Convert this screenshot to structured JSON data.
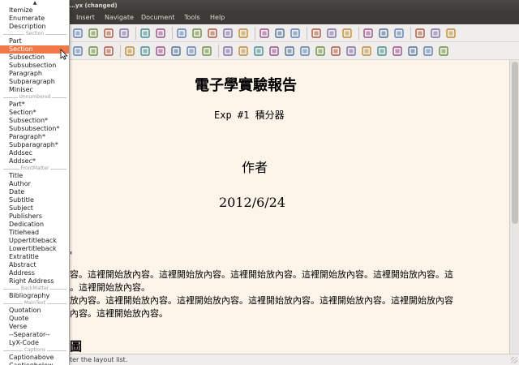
{
  "window": {
    "title": "…yx (changed)"
  },
  "menu": [
    "Insert",
    "Navigate",
    "Document",
    "Tools",
    "Help"
  ],
  "document": {
    "title": "電子學實驗報告",
    "subtitle": "Exp #1 積分器",
    "author": "作者",
    "date": "2012/6/24",
    "section_mark": "'",
    "para1_line1": "容。這裡開始放內容。這裡開始放內容。這裡開始放內容。這裡開始放內容。這裡開始放內容。這",
    "para1_line2": "。這裡開始放內容。",
    "para2_line1": "放內容。這裡開始放內容。這裡開始放內容。這裡開始放內容。這裡開始放內容。這裡開始放內容",
    "para2_line2": "內容。這裡開始放內容。",
    "figure_label": "圖"
  },
  "status": {
    "text": "ter the layout list."
  },
  "layout_popup": {
    "items": [
      {
        "label": "Itemize"
      },
      {
        "label": "Enumerate"
      },
      {
        "label": "Description"
      },
      {
        "category": "Section"
      },
      {
        "label": "Part"
      },
      {
        "label": "Section",
        "selected": true
      },
      {
        "label": "Subsection"
      },
      {
        "label": "Subsubsection"
      },
      {
        "label": "Paragraph"
      },
      {
        "label": "Subparagraph"
      },
      {
        "label": "Minisec"
      },
      {
        "category": "Unnumbered"
      },
      {
        "label": "Part*"
      },
      {
        "label": "Section*"
      },
      {
        "label": "Subsection*"
      },
      {
        "label": "Subsubsection*"
      },
      {
        "label": "Paragraph*"
      },
      {
        "label": "Subparagraph*"
      },
      {
        "label": "Addsec"
      },
      {
        "label": "Addsec*"
      },
      {
        "category": "FrontMatter"
      },
      {
        "label": "Title"
      },
      {
        "label": "Author"
      },
      {
        "label": "Date"
      },
      {
        "label": "Subtitle"
      },
      {
        "label": "Subject"
      },
      {
        "label": "Publishers"
      },
      {
        "label": "Dedication"
      },
      {
        "label": "Titlehead"
      },
      {
        "label": "Uppertitleback"
      },
      {
        "label": "Lowertitleback"
      },
      {
        "label": "Extratitle"
      },
      {
        "label": "Abstract"
      },
      {
        "label": "Address"
      },
      {
        "label": "Right Address"
      },
      {
        "category": "BackMatter"
      },
      {
        "label": "Bibliography"
      },
      {
        "category": "MainText"
      },
      {
        "label": "Quotation"
      },
      {
        "label": "Quote"
      },
      {
        "label": "Verse"
      },
      {
        "label": "--Separator--"
      },
      {
        "label": "LyX-Code"
      },
      {
        "category": "Captions"
      },
      {
        "label": "Captionabove"
      },
      {
        "label": "Captionbelow"
      }
    ]
  },
  "toolbar1": [
    "new-doc-icon",
    "save-icon",
    "save-as-icon",
    "print-icon",
    "sep",
    "spellcheck-icon",
    "check-icon",
    "sep",
    "undo-icon",
    "redo-icon",
    "cut-icon",
    "copy-icon",
    "paste-icon",
    "sep",
    "find-icon",
    "find-replace-icon",
    "zoom-icon",
    "sep",
    "math-mode-icon",
    "emphasize-icon",
    "noun-icon",
    "sep",
    "sum-icon",
    "chart-icon",
    "table-icon",
    "sep",
    "compass-icon",
    "formula-icon",
    "close-icon"
  ],
  "toolbar2": [
    "layout-icon",
    "doc-settings-icon",
    "view-icon",
    "sep",
    "list-icon",
    "list-numbered-icon",
    "list-desc-icon",
    "list-item-icon",
    "depth-decrease-icon",
    "depth-increase-icon",
    "sep",
    "insert-graphics-icon",
    "insert-table-icon",
    "insert-label-icon",
    "insert-ref-icon",
    "insert-cite-icon",
    "insert-index-icon",
    "insert-nomencl-icon",
    "insert-footnote-icon",
    "insert-marginnote-icon",
    "insert-note-icon",
    "insert-box-icon",
    "insert-url-icon",
    "insert-tex-icon",
    "insert-math-icon",
    "insert-attachment-icon"
  ],
  "colors": {
    "accent": "#f07746",
    "doc_bg": "#fdf4ea",
    "titlebar": "#3c3b37"
  }
}
